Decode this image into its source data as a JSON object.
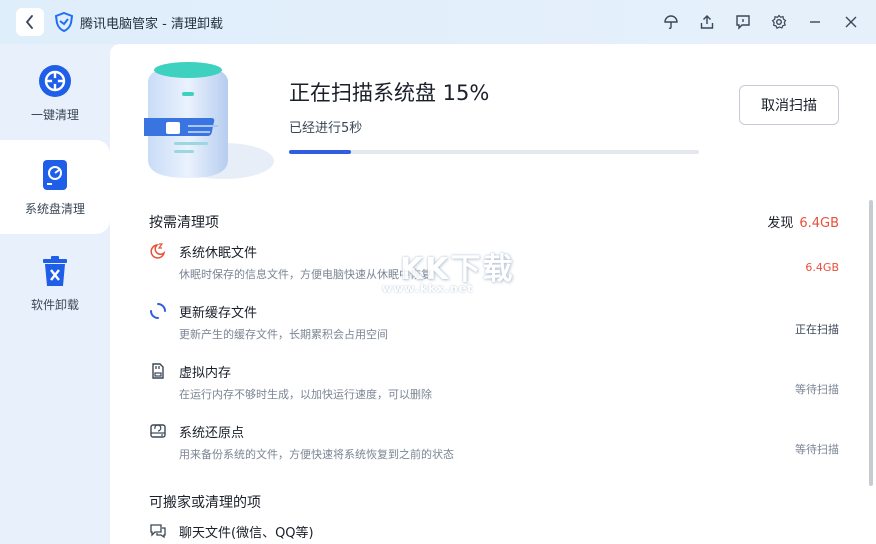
{
  "app": {
    "title": "腾讯电脑管家 - 清理卸载"
  },
  "colors": {
    "accent": "#2f5fe0",
    "highlight": "#e8503a"
  },
  "sidebar": {
    "items": [
      {
        "label": "一键清理",
        "icon": "broom-circle-icon",
        "active": false
      },
      {
        "label": "系统盘清理",
        "icon": "system-disk-icon",
        "active": true
      },
      {
        "label": "软件卸载",
        "icon": "trash-icon",
        "active": false
      }
    ]
  },
  "scan": {
    "title": "正在扫描系统盘 15%",
    "elapsed": "已经进行5秒",
    "progress": 0.15,
    "cancel_label": "取消扫描"
  },
  "section1": {
    "title": "按需清理项",
    "found_label": "发现",
    "found_value": "6.4GB",
    "items": [
      {
        "name": "系统休眠文件",
        "desc": "休眠时保存的信息文件，方便电脑快速从休眠中恢复",
        "status": "6.4GB",
        "icon": "moon-sleep-icon"
      },
      {
        "name": "更新缓存文件",
        "desc": "更新产生的缓存文件，长期累积会占用空间",
        "status": "正在扫描",
        "icon": "loading-spinner-icon"
      },
      {
        "name": "虚拟内存",
        "desc": "在运行内存不够时生成，以加快运行速度，可以删除",
        "status": "等待扫描",
        "icon": "memory-card-icon"
      },
      {
        "name": "系统还原点",
        "desc": "用来备份系统的文件，方便快速将系统恢复到之前的状态",
        "status": "等待扫描",
        "icon": "restore-disk-icon"
      }
    ]
  },
  "section2": {
    "title": "可搬家或清理的项",
    "items": [
      {
        "name": "聊天文件(微信、QQ等)",
        "icon": "chat-icon"
      }
    ]
  },
  "watermark": {
    "text": "KK下载",
    "url": "www.kkx.net"
  }
}
